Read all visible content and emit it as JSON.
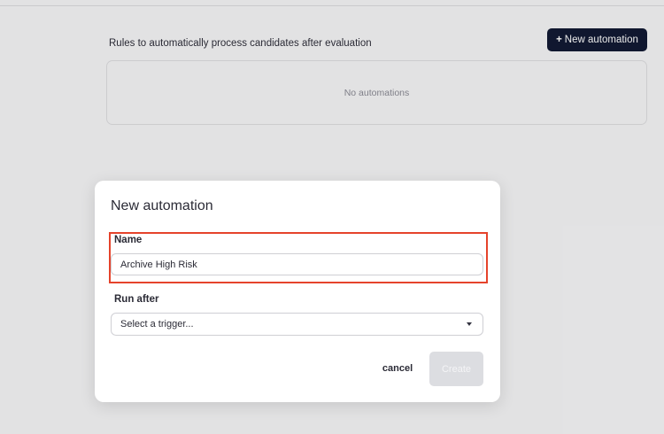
{
  "page": {
    "subtitle": "Rules to automatically process candidates after evaluation",
    "new_button": {
      "plus": "+",
      "label": "New automation"
    },
    "empty_state": "No automations"
  },
  "modal": {
    "title": "New automation",
    "name_label": "Name",
    "name_value": "Archive High Risk",
    "run_after_label": "Run after",
    "trigger_placeholder": "Select a trigger...",
    "cancel_label": "cancel",
    "create_label": "Create"
  },
  "colors": {
    "primary_button": "#121a33",
    "highlight_border": "#e5432b",
    "disabled_button": "#dcdde1"
  },
  "icons": {
    "dropdown": "caret-down-icon"
  }
}
